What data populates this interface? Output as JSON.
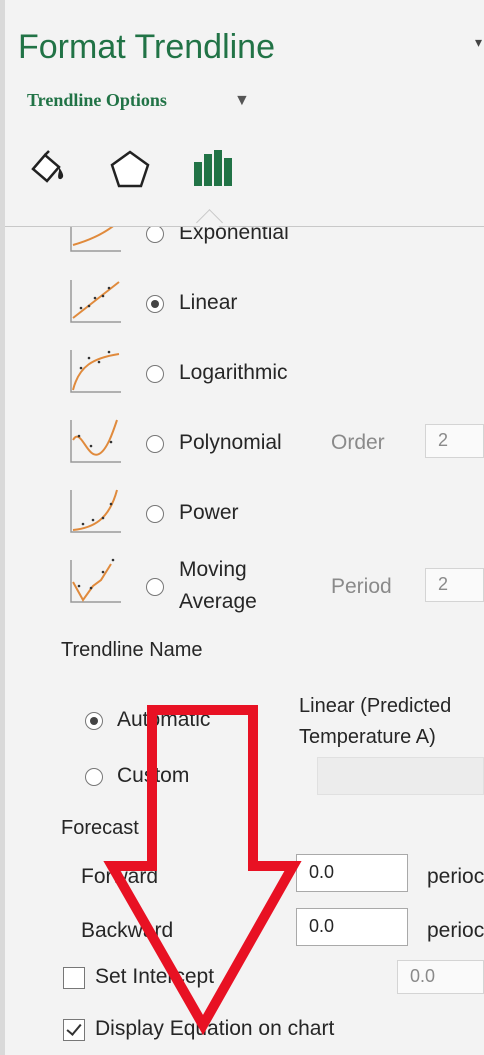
{
  "pane": {
    "title": "Format Trendline",
    "options_label": "Trendline Options",
    "tabs": [
      {
        "icon": "fill-line-icon"
      },
      {
        "icon": "effects-pentagon-icon"
      },
      {
        "icon": "trendline-options-bar-icon",
        "active": true
      }
    ]
  },
  "types": [
    {
      "label": "Exponential",
      "selected": false
    },
    {
      "label": "Linear",
      "selected": true
    },
    {
      "label": "Logarithmic",
      "selected": false
    },
    {
      "label": "Polynomial",
      "selected": false,
      "extra_label": "Order",
      "extra_value": "2"
    },
    {
      "label": "Power",
      "selected": false
    },
    {
      "label_line1": "Moving",
      "label_line2": "Average",
      "selected": false,
      "extra_label": "Period",
      "extra_value": "2"
    }
  ],
  "trendline_name": {
    "heading": "Trendline Name",
    "automatic_label": "Automatic",
    "automatic_selected": true,
    "automatic_value_line1": "Linear (Predicted",
    "automatic_value_line2": "Temperature A)",
    "custom_label": "Custom",
    "custom_selected": false
  },
  "forecast": {
    "heading": "Forecast",
    "forward_label": "Forward",
    "forward_value": "0.0",
    "backward_label": "Backward",
    "backward_value": "0.0",
    "unit": "perioc"
  },
  "set_intercept": {
    "label": "Set Intercept",
    "checked": false,
    "value": "0.0"
  },
  "display_equation": {
    "label": "Display Equation on chart",
    "checked": true
  },
  "colors": {
    "accent": "#217346",
    "annotation_arrow": "#e81123"
  }
}
